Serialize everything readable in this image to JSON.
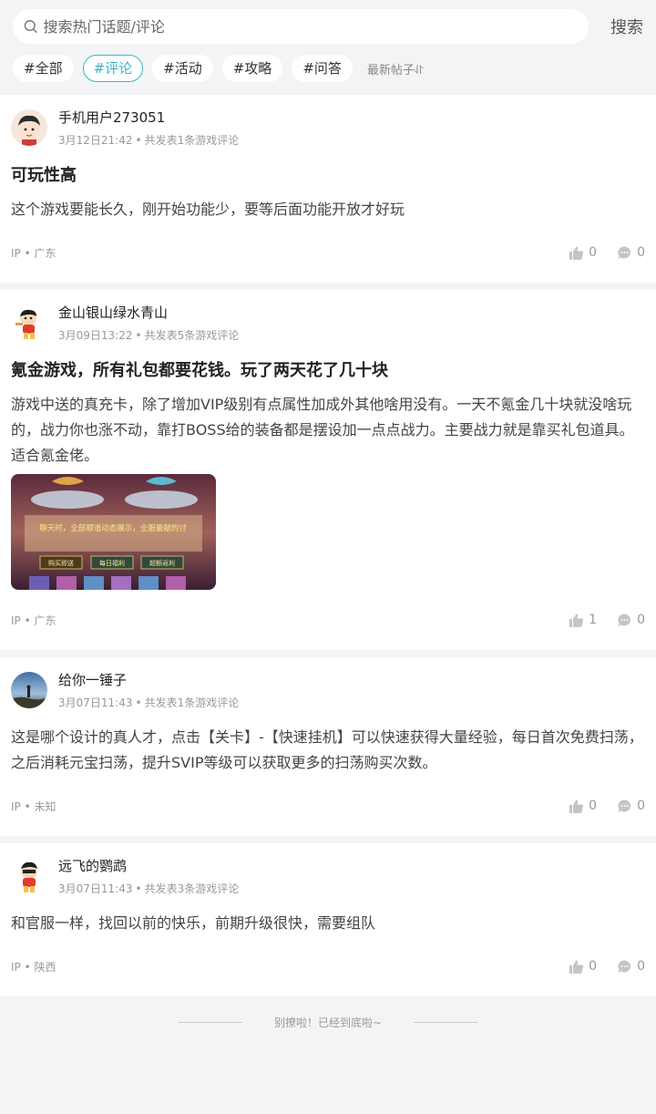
{
  "search": {
    "placeholder": "搜索热门话题/评论",
    "button_label": "搜索"
  },
  "filters": {
    "tags": [
      "#全部",
      "#评论",
      "#活动",
      "#攻略",
      "#问答"
    ],
    "active": "#评论",
    "sort_label": "最新帖子⥯"
  },
  "posts": [
    {
      "author": "手机用户273051",
      "date": "3月12日21:42",
      "stats": "共发表1条游戏评论",
      "title": "可玩性高",
      "content": "这个游戏要能长久，刚开始功能少，要等后面功能开放才好玩",
      "ip_prefix": "IP",
      "location": "广东",
      "likes": "0",
      "comments": "0"
    },
    {
      "author": "金山银山绿水青山",
      "date": "3月09日13:22",
      "stats": "共发表5条游戏评论",
      "title": "氪金游戏，所有礼包都要花钱。玩了两天花了几十块",
      "content": "游戏中送的真充卡，除了增加VIP级别有点属性加成外其他啥用没有。一天不氪金几十块就没啥玩的，战力你也涨不动，靠打BOSS给的装备都是摆设加一点点战力。主要战力就是靠买礼包道具。适合氪金佬。",
      "image": {
        "notice": "聊天时，全部顺道动态展示，全服最献的讨",
        "buttons": [
          "购买即送",
          "每日福利",
          "超额返利"
        ]
      },
      "ip_prefix": "IP",
      "location": "广东",
      "likes": "1",
      "comments": "0"
    },
    {
      "author": "给你一锤子",
      "date": "3月07日11:43",
      "stats": "共发表1条游戏评论",
      "content": "这是哪个设计的真人才，点击【关卡】-【快速挂机】可以快速获得大量经验，每日首次免费扫荡，之后消耗元宝扫荡，提升SVIP等级可以获取更多的扫荡购买次数。",
      "ip_prefix": "IP",
      "location": "未知",
      "likes": "0",
      "comments": "0"
    },
    {
      "author": "远飞的鹦鹉",
      "date": "3月07日11:43",
      "stats": "共发表3条游戏评论",
      "content": "和官服一样，找回以前的快乐，前期升级很快，需要组队",
      "ip_prefix": "IP",
      "location": "陕西",
      "likes": "0",
      "comments": "0"
    }
  ],
  "footer": {
    "end_text": "别撩啦！已经到底啦~"
  },
  "colors": {
    "accent": "#3cb4c4",
    "background": "#f3f4f6",
    "muted": "#999999"
  },
  "icons": [
    "search-icon",
    "thumb-up-icon",
    "comment-icon"
  ]
}
